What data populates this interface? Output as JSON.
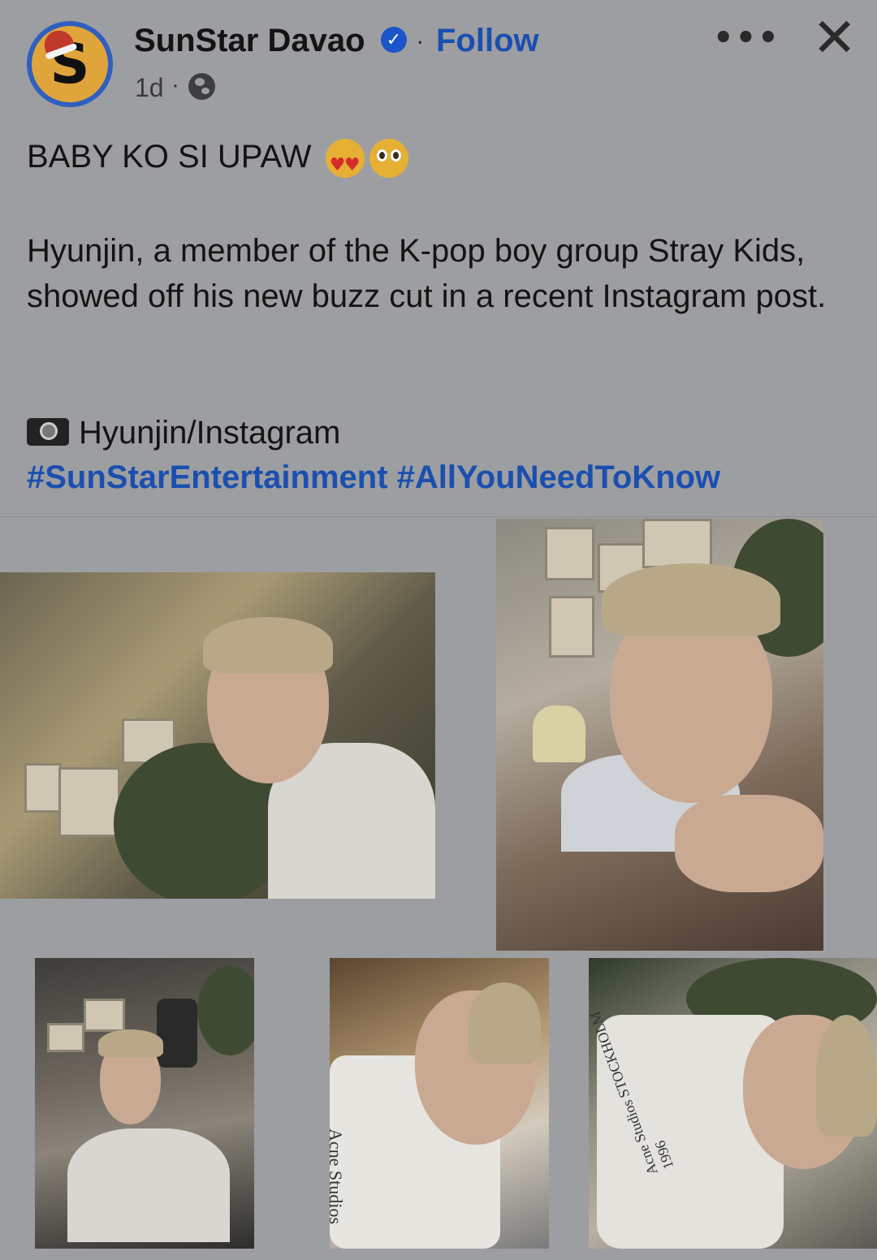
{
  "post": {
    "page_name": "SunStar Davao",
    "follow_label": "Follow",
    "separator": "·",
    "timestamp": "1d",
    "avatar_letter": "S",
    "more_label": "•••",
    "close_label": "✕"
  },
  "content": {
    "headline": "BABY KO SI UPAW",
    "paragraph": "Hyunjin, a member of the K-pop boy group Stray Kids, showed off his new buzz cut in a recent Instagram post.",
    "credit": "Hyunjin/Instagram",
    "hashtags": [
      "#SunStarEntertainment",
      "#AllYouNeedToKnow"
    ]
  },
  "photos": [
    {
      "label": "Photo 1"
    },
    {
      "label": "Photo 2"
    },
    {
      "label": "Photo 3"
    },
    {
      "label": "Photo 4",
      "shirt_text": "Acne Studios STOCKHOLM"
    },
    {
      "label": "Photo 5",
      "shirt_text": "Acne Studios STOCKHOLM 1996"
    }
  ],
  "icons": {
    "verified": "verified-badge-icon",
    "globe": "globe-icon",
    "camera": "camera-icon",
    "more": "more-options-icon",
    "close": "close-icon"
  },
  "colors": {
    "background": "#9d9ea1",
    "link": "#1a4fb0",
    "verified": "#1a55c9",
    "avatar_ring": "#2f5fbf",
    "avatar_fill": "#e0a53a"
  }
}
